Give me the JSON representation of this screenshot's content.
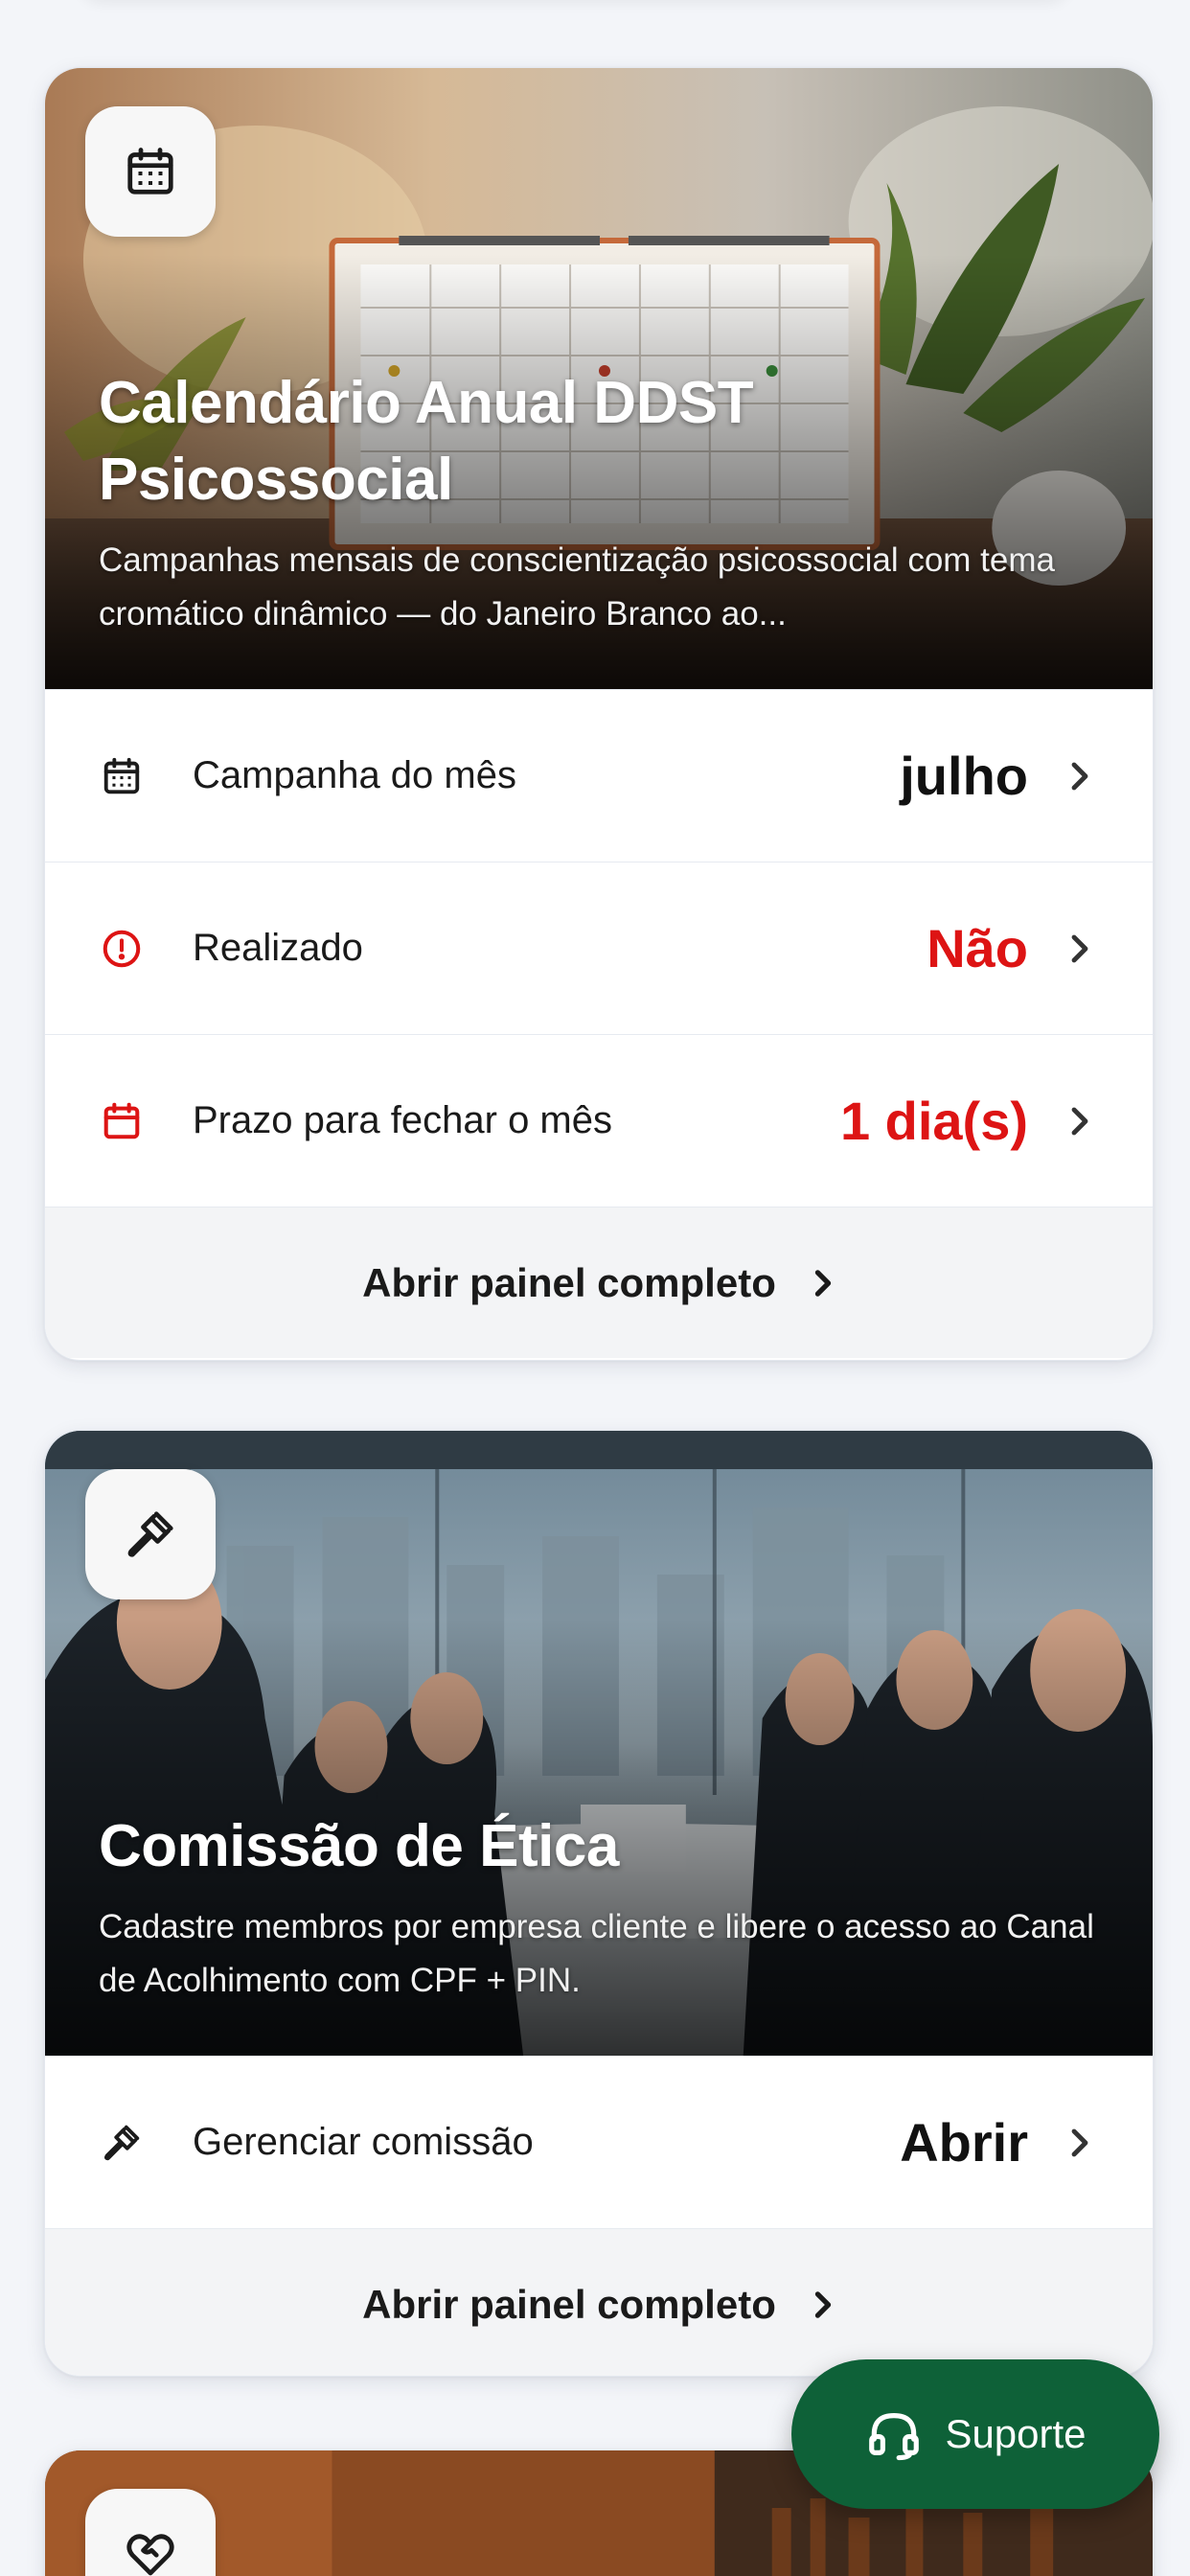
{
  "calendar_card": {
    "title": "Calendário Anual DDST Psicossocial",
    "description": "Campanhas mensais de conscientização psicossocial com tema cromático dinâmico — do Janeiro Branco ao...",
    "icon": "calendar-icon",
    "rows": [
      {
        "label": "Campanha do mês",
        "value": "julho",
        "icon": "calendar-icon",
        "color": "#111111"
      },
      {
        "label": "Realizado",
        "value": "Não",
        "icon": "alert-circle-icon",
        "color": "#dd1414"
      },
      {
        "label": "Prazo para fechar o mês",
        "value": "1 dia(s)",
        "icon": "calendar-deadline-icon",
        "color": "#dd1414"
      }
    ],
    "footer_label": "Abrir painel completo"
  },
  "ethics_card": {
    "title": "Comissão de Ética",
    "description": "Cadastre membros por empresa cliente e libere o acesso ao Canal de Acolhimento com CPF + PIN.",
    "icon": "gavel-icon",
    "rows": [
      {
        "label": "Gerenciar comissão",
        "value": "Abrir",
        "icon": "gavel-icon",
        "color": "#111111"
      }
    ],
    "footer_label": "Abrir painel completo"
  },
  "third_card": {
    "icon": "heart-handshake-icon"
  },
  "support_button": {
    "label": "Suporte",
    "icon": "headset-icon",
    "color": "#0e6138"
  },
  "colors": {
    "alert": "#dd1414",
    "support_green": "#0e6138",
    "footer_bg": "#f3f4f6"
  }
}
